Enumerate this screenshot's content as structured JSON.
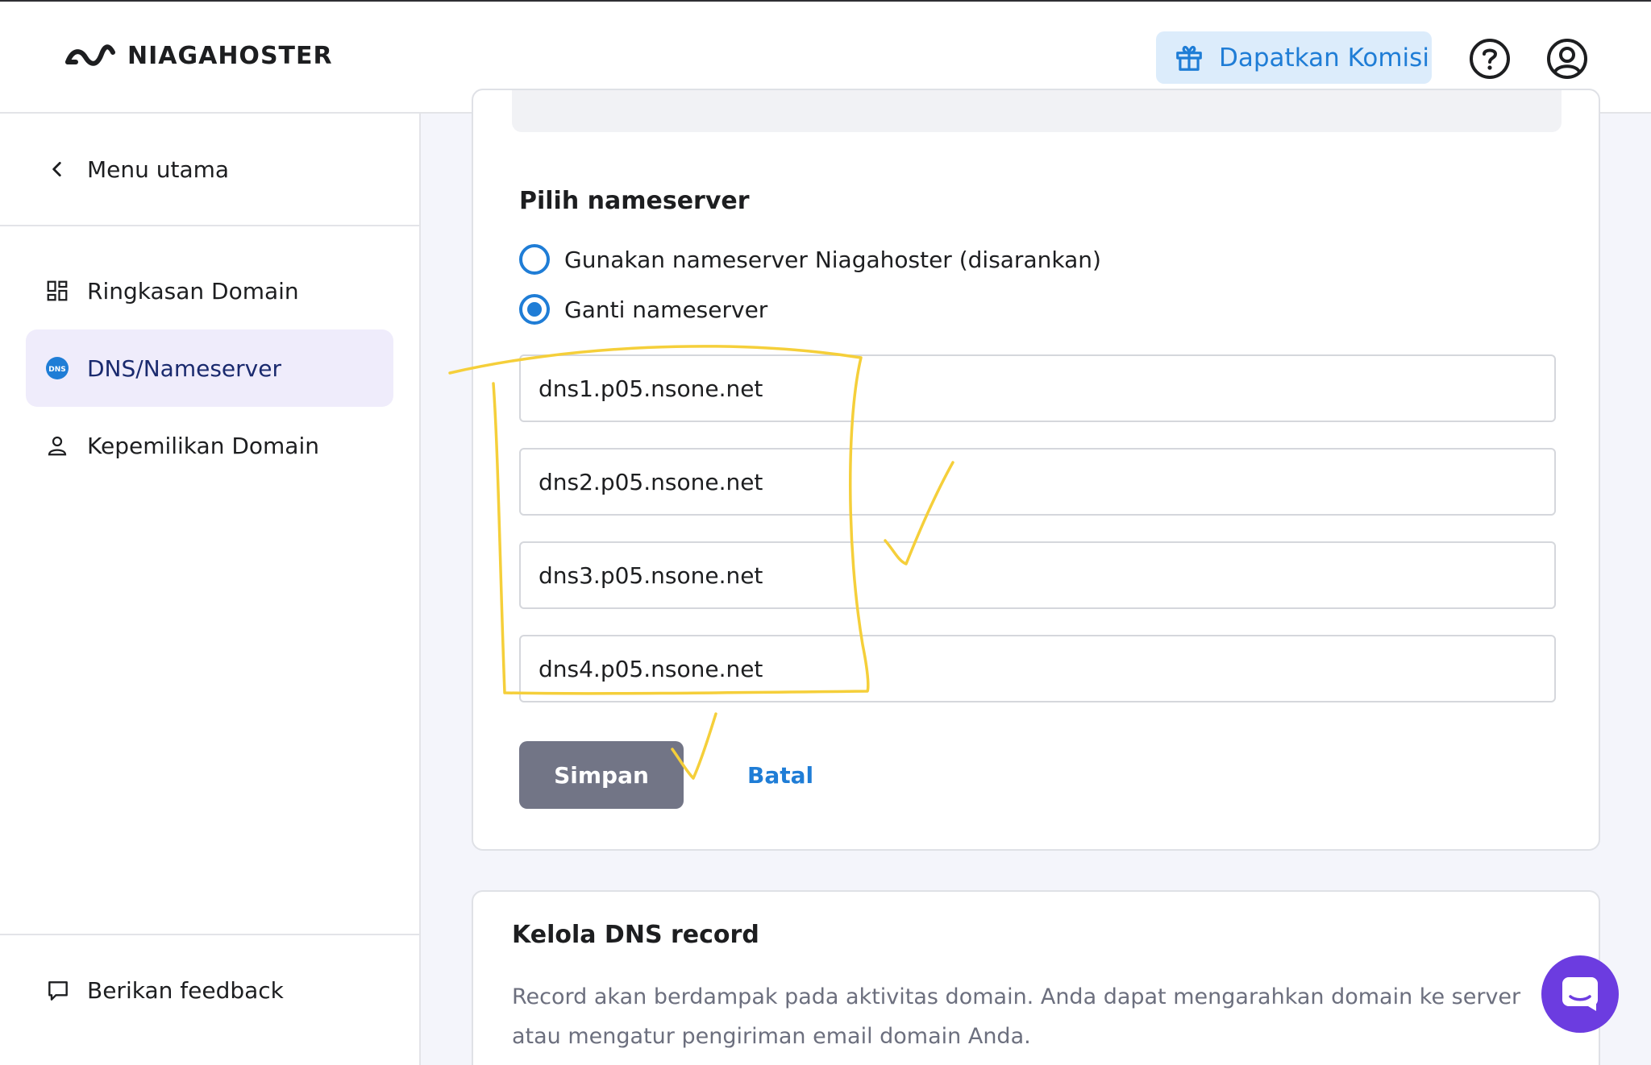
{
  "header": {
    "brand": "NIAGAHOSTER",
    "cta_label": "Dapatkan Komisi",
    "icons": [
      "gift-icon",
      "help-icon",
      "account-icon"
    ]
  },
  "sidebar": {
    "back_label": "Menu utama",
    "items": [
      {
        "label": "Ringkasan Domain",
        "icon": "dashboard-grid-icon",
        "active": false
      },
      {
        "label": "DNS/Nameserver",
        "icon": "dns-icon",
        "active": true
      },
      {
        "label": "Kepemilikan Domain",
        "icon": "person-icon",
        "active": false
      }
    ],
    "feedback_label": "Berikan feedback"
  },
  "nameserver_card": {
    "title": "Pilih nameserver",
    "options": [
      {
        "label": "Gunakan nameserver Niagahoster (disarankan)",
        "selected": false
      },
      {
        "label": "Ganti nameserver",
        "selected": true
      }
    ],
    "nameservers": [
      "dns1.p05.nsone.net",
      "dns2.p05.nsone.net",
      "dns3.p05.nsone.net",
      "dns4.p05.nsone.net"
    ],
    "save_label": "Simpan",
    "cancel_label": "Batal"
  },
  "dns_record_card": {
    "title": "Kelola DNS record",
    "description": "Record akan berdampak pada aktivitas domain. Anda dapat mengarahkan domain ke server atau mengatur pengiriman email domain Anda."
  },
  "colors": {
    "accent": "#1f7dd6",
    "annotation": "#f5cf3a",
    "chat": "#6c3ce0",
    "save_button": "#727586"
  }
}
